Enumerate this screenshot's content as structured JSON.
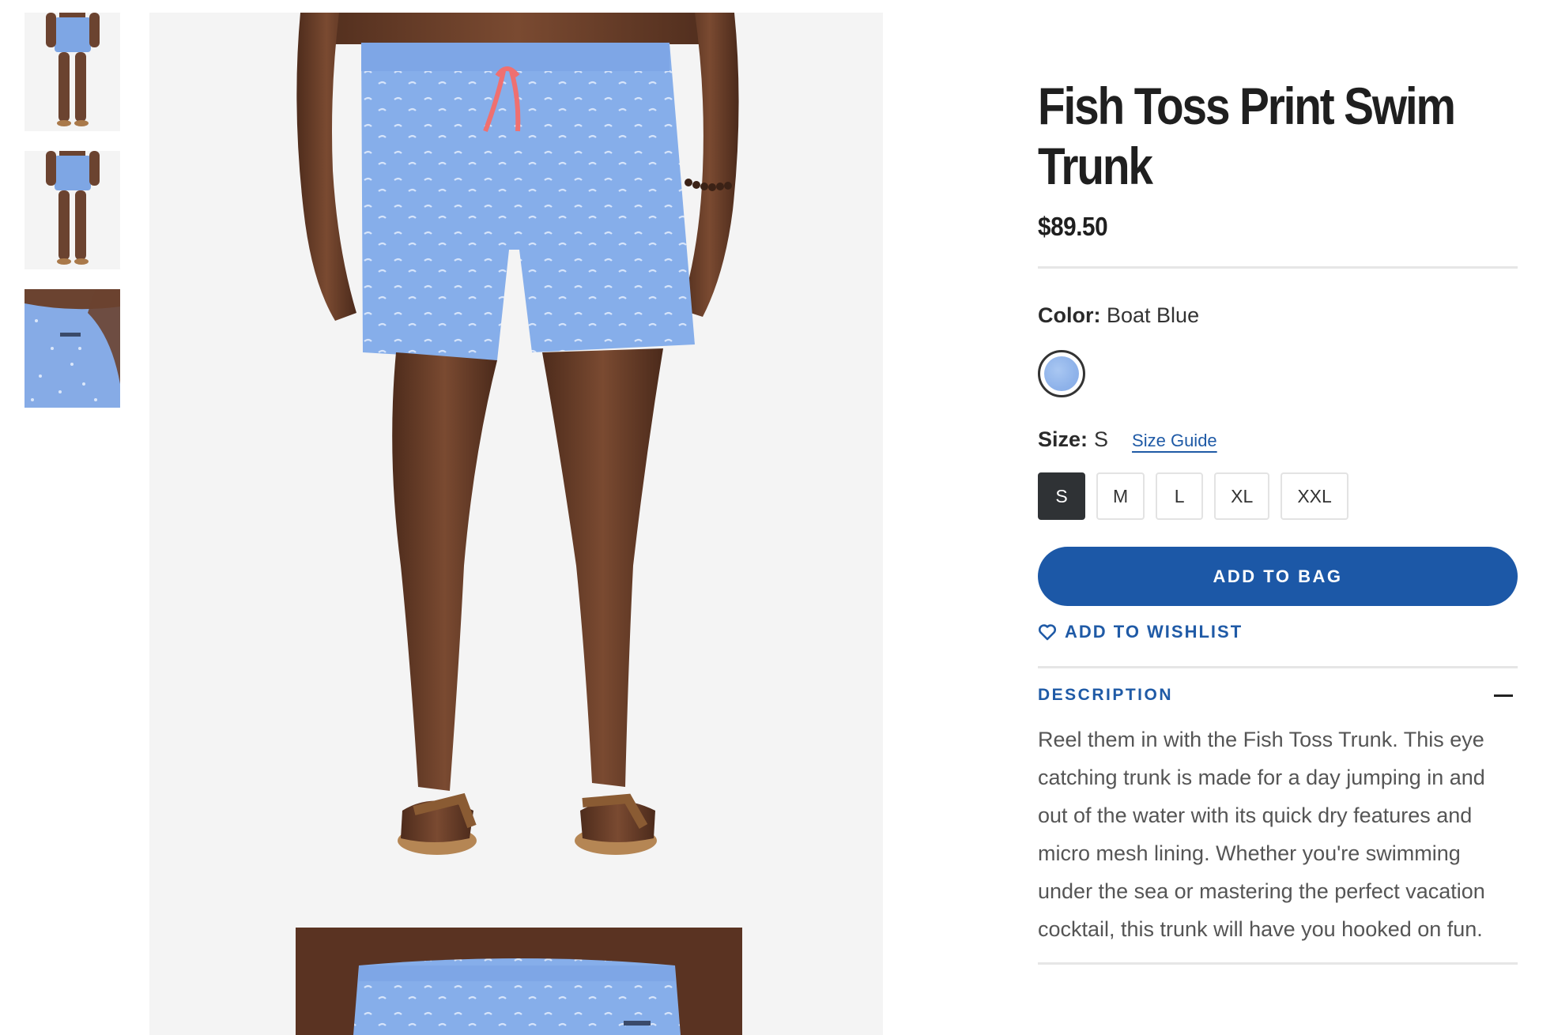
{
  "thumbnails": [
    {
      "name": "Front view"
    },
    {
      "name": "Back view"
    },
    {
      "name": "Detail view"
    }
  ],
  "product": {
    "title": "Fish Toss Print Swim Trunk",
    "price": "$89.50",
    "color_label": "Color:",
    "color_value": "Boat Blue",
    "size_label": "Size:",
    "size_value": "S",
    "size_guide": "Size Guide",
    "sizes": [
      "S",
      "M",
      "L",
      "XL",
      "XXL"
    ],
    "selected_size": "S",
    "add_to_bag": "ADD TO BAG",
    "add_to_wishlist": "ADD TO WISHLIST",
    "description_title": "DESCRIPTION",
    "description": "Reel them in with the Fish Toss Trunk. This eye catching trunk is made for a day jumping in and out of the water with its quick dry features and micro mesh lining. Whether you're swimming under the sea or mastering the perfect vacation cocktail, this trunk will have you hooked on fun."
  },
  "colors": {
    "accent": "#1c58a7",
    "swatch": "#8fb3ea",
    "selected_size_bg": "#2f3235"
  },
  "icons": {
    "wishlist": "heart-outline-icon",
    "collapse": "minus-icon"
  }
}
